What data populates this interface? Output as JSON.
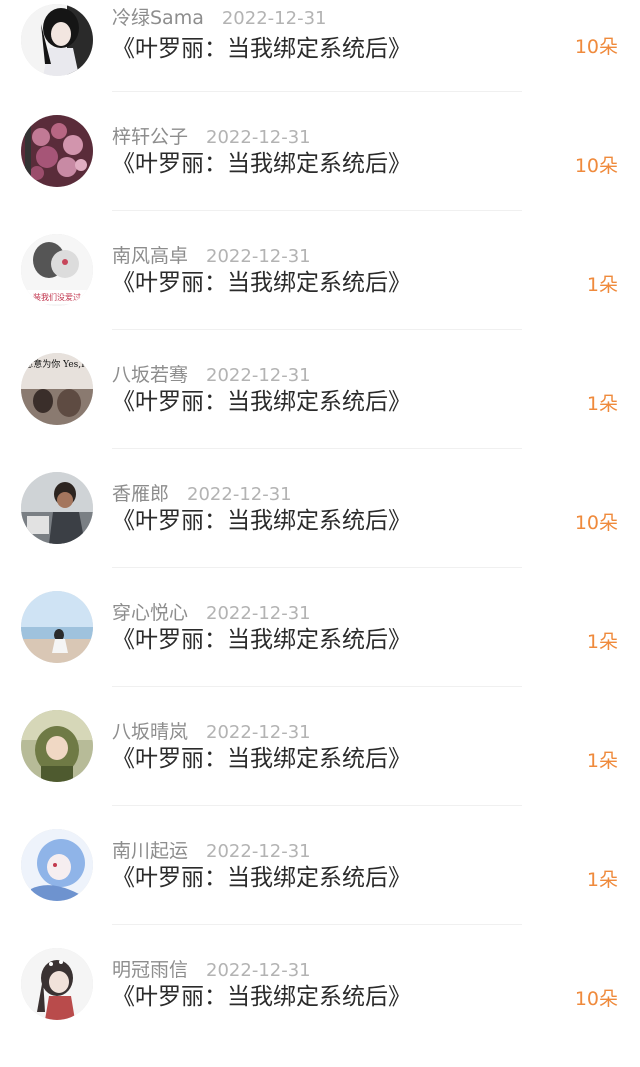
{
  "items": [
    {
      "user": "冷绿Sama",
      "date": "2022-12-31",
      "book": "《叶罗丽：当我绑定系统后》",
      "gift": "10朵",
      "avatar_icon": "avatar-girl-dark-hair"
    },
    {
      "user": "梓轩公子",
      "date": "2022-12-31",
      "book": "《叶罗丽：当我绑定系统后》",
      "gift": "10朵",
      "avatar_icon": "avatar-pink-flowers"
    },
    {
      "user": "南风高卓",
      "date": "2022-12-31",
      "book": "《叶罗丽：当我绑定系统后》",
      "gift": "1朵",
      "avatar_icon": "avatar-sketch-girl",
      "avatar_text": "装我们没爱过"
    },
    {
      "user": "八坂若骞",
      "date": "2022-12-31",
      "book": "《叶罗丽：当我绑定系统后》",
      "gift": "1朵",
      "avatar_icon": "avatar-couple-text",
      "avatar_text": "我愿意为你 Yes,I do"
    },
    {
      "user": "香雁郎",
      "date": "2022-12-31",
      "book": "《叶罗丽：当我绑定系统后》",
      "gift": "10朵",
      "avatar_icon": "avatar-man-photo"
    },
    {
      "user": "穿心悦心",
      "date": "2022-12-31",
      "book": "《叶罗丽：当我绑定系统后》",
      "gift": "1朵",
      "avatar_icon": "avatar-beach-girl"
    },
    {
      "user": "八坂晴岚",
      "date": "2022-12-31",
      "book": "《叶罗丽：当我绑定系统后》",
      "gift": "1朵",
      "avatar_icon": "avatar-green-anime"
    },
    {
      "user": "南川起运",
      "date": "2022-12-31",
      "book": "《叶罗丽：当我绑定系统后》",
      "gift": "1朵",
      "avatar_icon": "avatar-blue-anime"
    },
    {
      "user": "明冠雨信",
      "date": "2022-12-31",
      "book": "《叶罗丽：当我绑定系统后》",
      "gift": "10朵",
      "avatar_icon": "avatar-anime-girl-braids"
    }
  ],
  "colors": {
    "gift": "#ef8a3c",
    "username": "#8d8d8d",
    "date": "#b3b3b3",
    "title": "#2b2b2b"
  }
}
